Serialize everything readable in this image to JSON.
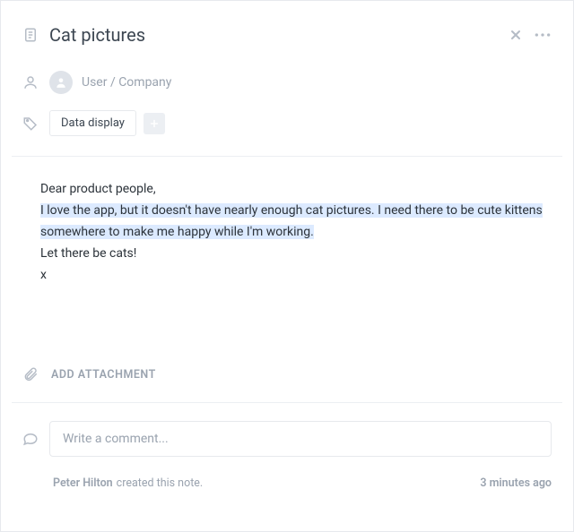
{
  "header": {
    "title": "Cat pictures"
  },
  "user": {
    "placeholder": "User / Company"
  },
  "tags": {
    "items": [
      {
        "label": "Data display"
      }
    ]
  },
  "note": {
    "line1": "Dear product people,",
    "highlight_a": "I love the app, but it doesn't have nearly enough cat pictures. I need there to be cute kittens",
    "highlight_b": "somewhere to make me happy while I'm working.",
    "line3": "Let there be cats!",
    "line4": "x"
  },
  "attachment": {
    "label": "ADD ATTACHMENT"
  },
  "comment": {
    "placeholder": "Write a comment..."
  },
  "audit": {
    "author": "Peter Hilton",
    "action": "created this note.",
    "time": "3 minutes ago"
  }
}
